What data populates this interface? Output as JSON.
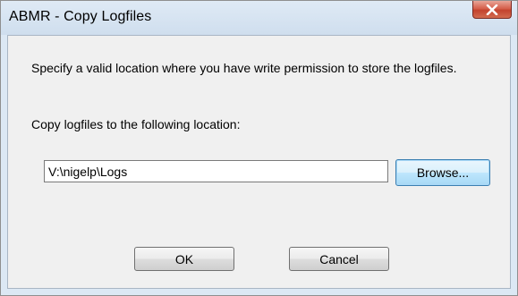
{
  "window": {
    "title": "ABMR - Copy Logfiles",
    "close_icon": "close-icon"
  },
  "dialog": {
    "instruction": "Specify a valid location where you have write permission to store the logfiles.",
    "location_label": "Copy logfiles to the following location:",
    "path_value": "V:\\nigelp\\Logs",
    "browse_label": "Browse...",
    "ok_label": "OK",
    "cancel_label": "Cancel"
  },
  "colors": {
    "close_button": "#c3432e",
    "focus_border": "#3c7fb1"
  }
}
